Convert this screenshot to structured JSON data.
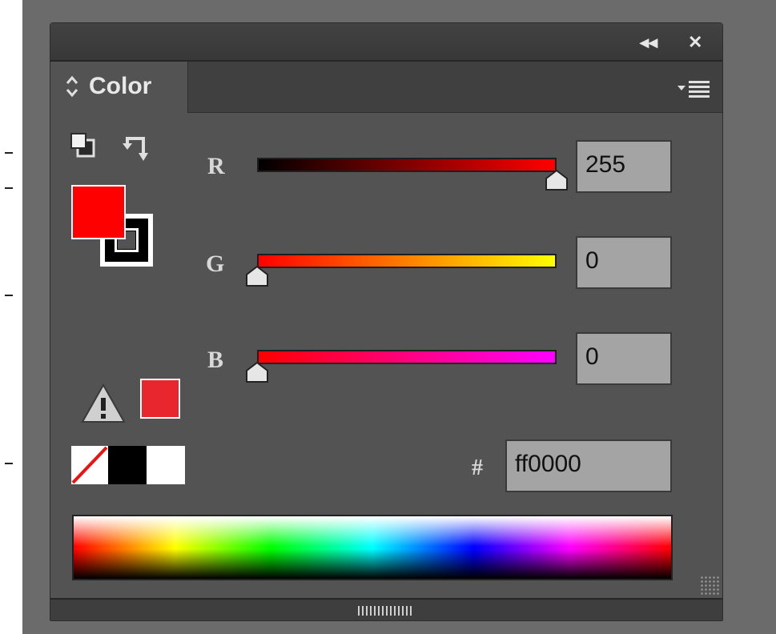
{
  "panel": {
    "title": "Color",
    "collapse_glyph": "◂◂",
    "close_glyph": "✕",
    "menu_icon": "panel-menu-icon"
  },
  "colors": {
    "fill": "#ff0000",
    "stroke": "#000000",
    "out_of_gamut_swatch": "#e8262d"
  },
  "channels": [
    {
      "label": "R",
      "value": "255",
      "fraction": 1.0
    },
    {
      "label": "G",
      "value": "0",
      "fraction": 0.0
    },
    {
      "label": "B",
      "value": "0",
      "fraction": 0.0
    }
  ],
  "hex": {
    "label": "#",
    "value": "ff0000"
  },
  "icons": {
    "default_colors": "default-fill-stroke-icon",
    "swap": "swap-fill-stroke-icon",
    "warning": "out-of-gamut-warning-icon",
    "none": "none-swatch-icon",
    "black": "black-swatch",
    "white": "white-swatch"
  }
}
